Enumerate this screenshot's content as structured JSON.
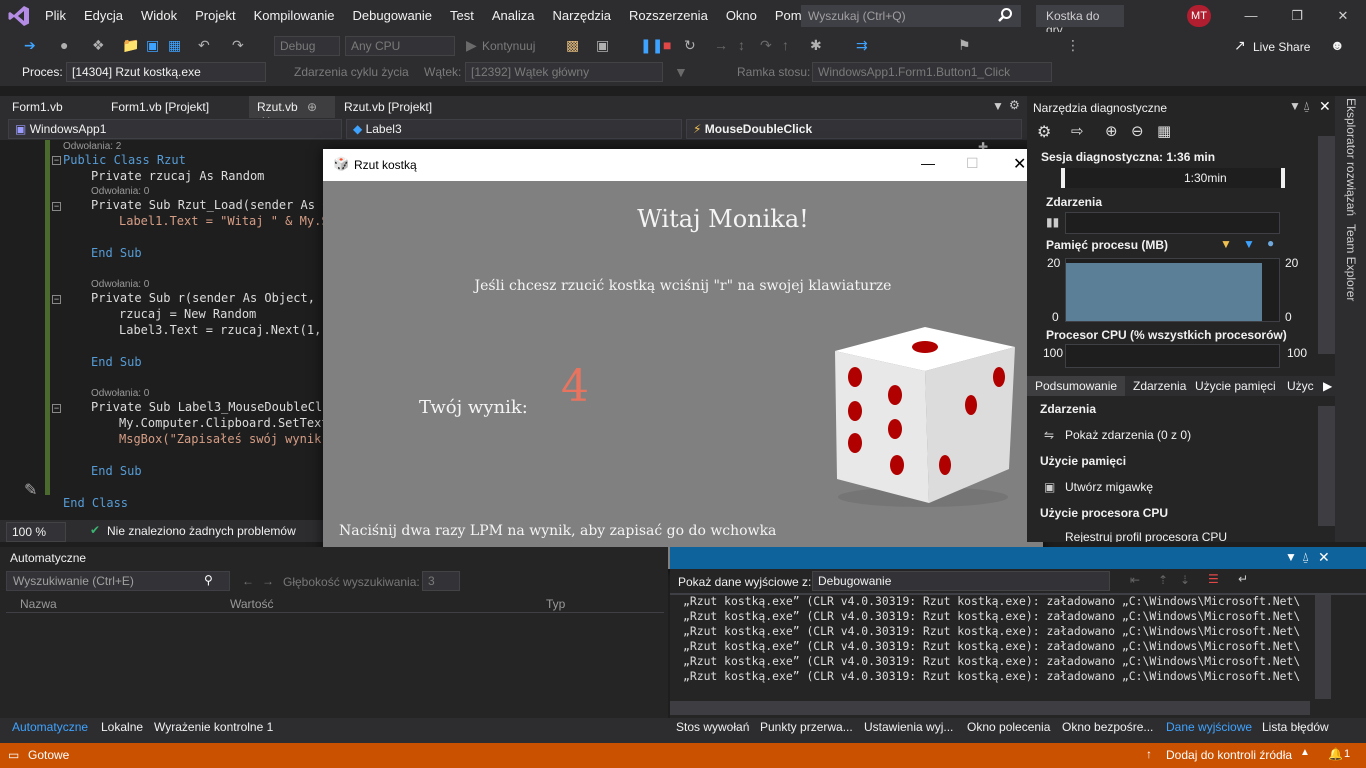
{
  "menu": [
    "Plik",
    "Edycja",
    "Widok",
    "Projekt",
    "Kompilowanie",
    "Debugowanie",
    "Test",
    "Analiza",
    "Narzędzia",
    "Rozszerzenia",
    "Okno",
    "Pomoc"
  ],
  "search_placeholder": "Wyszukaj (Ctrl+Q)",
  "solution_name": "Kostka do gry",
  "user_initials": "MT",
  "toolbar": {
    "config": "Debug",
    "platform": "Any CPU",
    "continue": "Kontynuuj",
    "live_share": "Live Share",
    "process_label": "Proces:",
    "process_value": "[14304] Rzut kostką.exe",
    "lifecycle": "Zdarzenia cyklu życia",
    "thread_label": "Wątek:",
    "thread_value": "[12392] Wątek główny",
    "frame_label": "Ramka stosu:",
    "frame_value": "WindowsApp1.Form1.Button1_Click"
  },
  "doc_tabs": [
    "Form1.vb",
    "Form1.vb [Projekt]",
    "Rzut.vb",
    "Rzut.vb [Projekt]"
  ],
  "nav": {
    "project": "WindowsApp1",
    "class": "Label3",
    "member": "MouseDoubleClick"
  },
  "code": {
    "refs2": "Odwołania: 2",
    "refs0a": "Odwołania: 0",
    "refs0b": "Odwołania: 0",
    "refs0c": "Odwołania: 0",
    "l1": "Public Class Rzut",
    "l2": "Private rzucaj As Random",
    "l3": "Private Sub Rzut_Load(sender As O",
    "l4": "Label1.Text = \"Witaj \" & My.S",
    "l5": "End Sub",
    "l6": "Private Sub r(sender As Object, e",
    "l7": "rzucaj = New Random",
    "l8": "Label3.Text = rzucaj.Next(1,",
    "l9": "End Sub",
    "l10": "Private Sub Label3_MouseDoubleCli",
    "l11": "My.Computer.Clipboard.SetText",
    "l12": "MsgBox(\"Zapisałeś swój wynik",
    "l13": "End Sub",
    "l14": "End Class"
  },
  "editor_status": {
    "zoom": "100 %",
    "problems": "Nie znaleziono żadnych problemów"
  },
  "dialog": {
    "title": "Rzut kostką",
    "greeting": "Witaj Monika!",
    "instruction": "Jeśli chcesz rzucić kostką wciśnij \"r\" na swojej klawiaturze",
    "result_label": "Twój wynik:",
    "result_value": "4",
    "hint": "Naciśnij dwa razy LPM na wynik, aby zapisać go do wchowka"
  },
  "diag": {
    "title": "Narzędzia diagnostyczne",
    "session": "Sesja diagnostyczna: 1:36 min",
    "time_mark": "1:30min",
    "events": "Zdarzenia",
    "memory": "Pamięć procesu (MB)",
    "mem_max": "20",
    "mem_min": "0",
    "cpu": "Procesor CPU (% wszystkich procesorów)",
    "cpu_max": "100",
    "tabs": [
      "Podsumowanie",
      "Zdarzenia",
      "Użycie pamięci",
      "Użyc"
    ],
    "sec_events": "Zdarzenia",
    "show_events": "Pokaż zdarzenia (0 z 0)",
    "sec_memory": "Użycie pamięci",
    "snapshot": "Utwórz migawkę",
    "sec_cpu": "Użycie procesora CPU",
    "cpu_profile": "Rejestruj profil procesora CPU",
    "memory_level_pct": 100
  },
  "side_tabs": [
    "Eksplorator rozwiązań",
    "Team Explorer"
  ],
  "autos": {
    "title": "Automatyczne",
    "search": "Wyszukiwanie (Ctrl+E)",
    "depth_label": "Głębokość wyszukiwania:",
    "depth": "3",
    "cols": [
      "Nazwa",
      "Wartość",
      "Typ"
    ]
  },
  "output": {
    "show_label": "Pokaż dane wyjściowe z:",
    "source": "Debugowanie",
    "lines": [
      "„Rzut kostką.exe” (CLR v4.0.30319: Rzut kostką.exe): załadowano „C:\\Windows\\Microsoft.Net\\",
      "„Rzut kostką.exe” (CLR v4.0.30319: Rzut kostką.exe): załadowano „C:\\Windows\\Microsoft.Net\\",
      "„Rzut kostką.exe” (CLR v4.0.30319: Rzut kostką.exe): załadowano „C:\\Windows\\Microsoft.Net\\",
      "„Rzut kostką.exe” (CLR v4.0.30319: Rzut kostką.exe): załadowano „C:\\Windows\\Microsoft.Net\\",
      "„Rzut kostką.exe” (CLR v4.0.30319: Rzut kostką.exe): załadowano „C:\\Windows\\Microsoft.Net\\",
      "„Rzut kostką.exe” (CLR v4.0.30319: Rzut kostką.exe): załadowano „C:\\Windows\\Microsoft.Net\\"
    ]
  },
  "bottom_tabs_left": [
    "Automatyczne",
    "Lokalne",
    "Wyrażenie kontrolne 1"
  ],
  "bottom_tabs_right": [
    "Stos wywołań",
    "Punkty przerwa...",
    "Ustawienia wyj...",
    "Okno polecenia",
    "Okno bezpośre...",
    "Dane wyjściowe",
    "Lista błędów"
  ],
  "status": {
    "ready": "Gotowe",
    "source_control": "Dodaj do kontroli źródła",
    "notifications": "1"
  },
  "colors": {
    "accent": "#3ea3ff",
    "status_bar": "#ca5100",
    "result": "#e8745f",
    "dialog_bg": "#808080"
  }
}
